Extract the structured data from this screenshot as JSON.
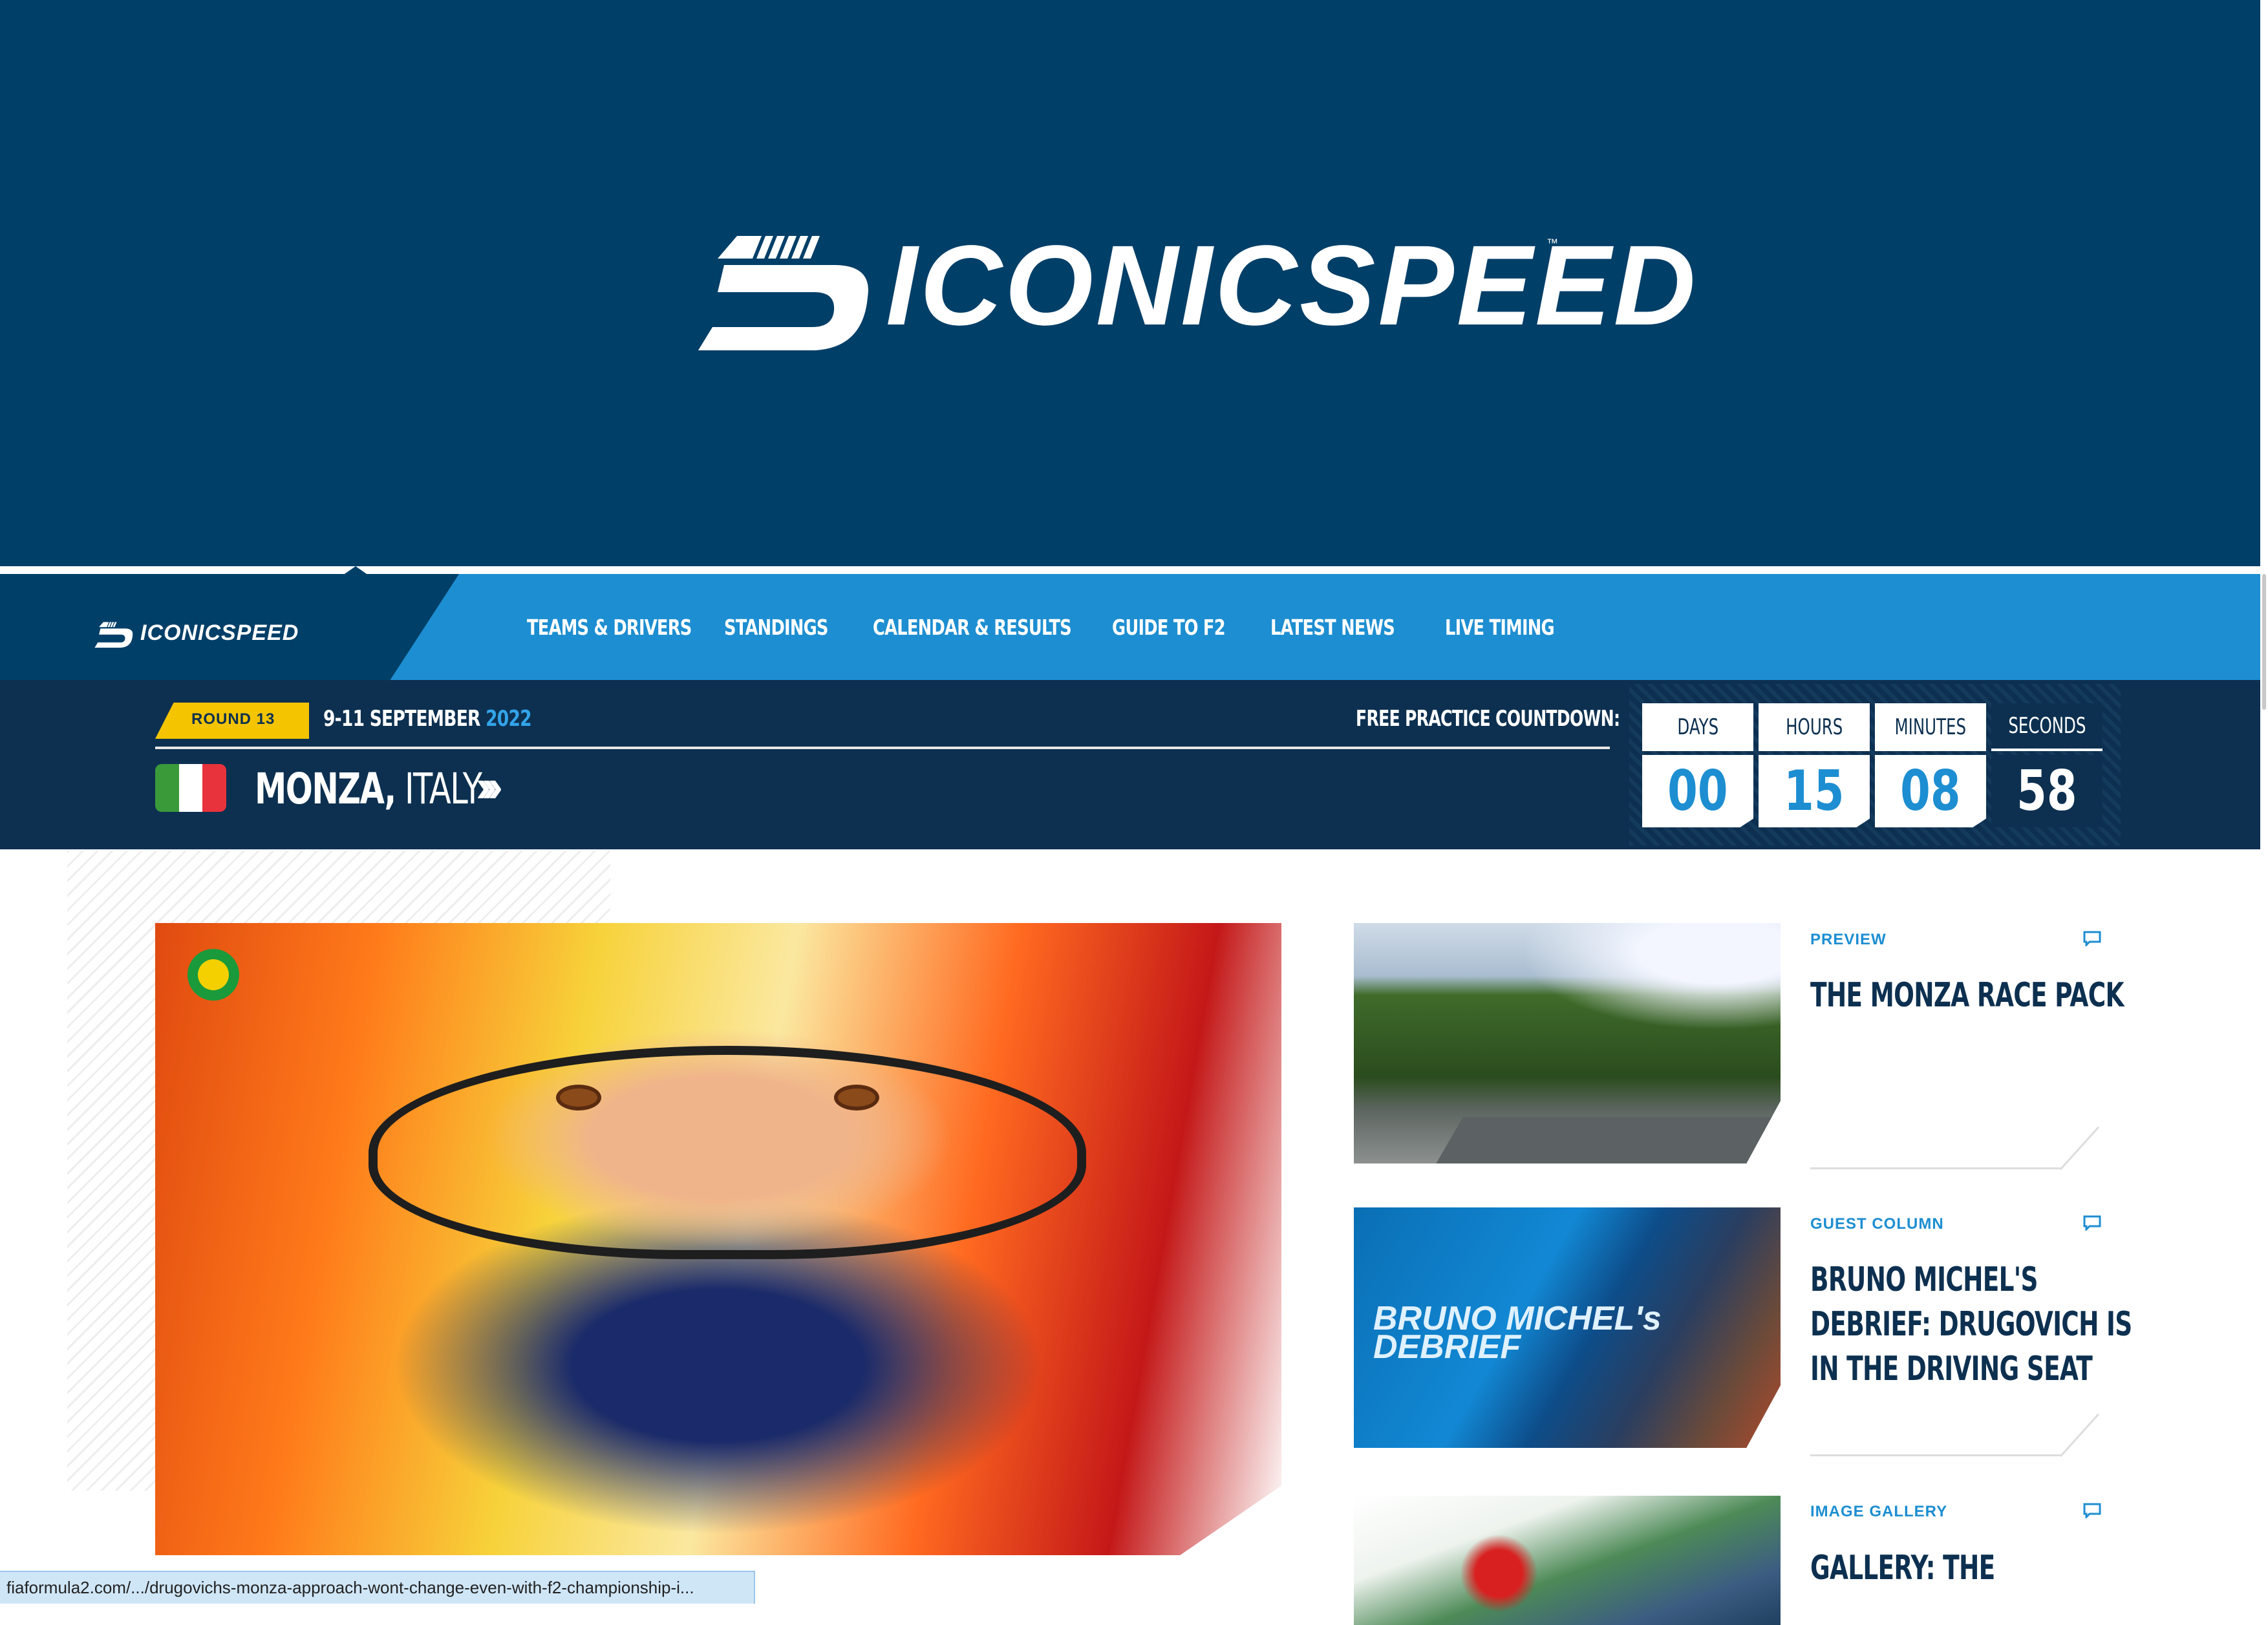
{
  "brand": {
    "name": "ICONICSPEED",
    "tm": "™"
  },
  "nav": {
    "items": [
      "TEAMS & DRIVERS",
      "STANDINGS",
      "CALENDAR & RESULTS",
      "GUIDE TO F2",
      "LATEST NEWS",
      "LIVE TIMING"
    ]
  },
  "race": {
    "round": "ROUND 13",
    "dates": "9-11 SEPTEMBER",
    "year": "2022",
    "circuit": "MONZA,",
    "country": "ITALY",
    "arrows": "›››",
    "countdown_label": "FREE PRACTICE COUNTDOWN:",
    "flag_colors": [
      "#3a9a3a",
      "#ffffff",
      "#e8323c"
    ]
  },
  "countdown": [
    {
      "label": "DAYS",
      "value": "00"
    },
    {
      "label": "HOURS",
      "value": "15"
    },
    {
      "label": "MINUTES",
      "value": "08"
    },
    {
      "label": "SECONDS",
      "value": "58"
    }
  ],
  "stories": [
    {
      "tag": "PREVIEW",
      "title": "THE MONZA RACE PACK"
    },
    {
      "tag": "GUEST COLUMN",
      "title": "BRUNO MICHEL'S DEBRIEF: DRUGOVICH IS IN THE DRIVING SEAT",
      "image_text": "BRUNO MICHEL's DEBRIEF"
    },
    {
      "tag": "IMAGE GALLERY",
      "title": "GALLERY: THE"
    }
  ],
  "status_url": "fiaformula2.com/.../drugovichs-monza-approach-wont-change-even-with-f2-championship-i...",
  "colors": {
    "navy": "#003f68",
    "blue": "#1d8ed1",
    "dark": "#0d3050",
    "yellow": "#f4c400"
  }
}
